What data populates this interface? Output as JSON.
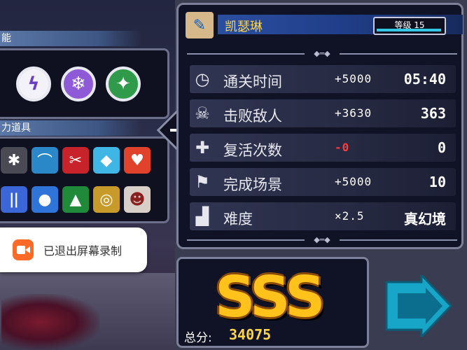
{
  "left_panel": {
    "skills_header": "能",
    "items_header": "力道具",
    "skills": [
      {
        "icon": "lightning-skill-icon",
        "glyph": "ϟ",
        "color": "#6a3fc4"
      },
      {
        "icon": "snowflake-skill-icon",
        "glyph": "❄",
        "color": "#8e5ad8"
      },
      {
        "icon": "leaf-skill-icon",
        "glyph": "✦",
        "color": "#2f9b4a"
      }
    ],
    "items": [
      {
        "icon": "spider-item-icon",
        "glyph": "✱",
        "color": "#4a4a55"
      },
      {
        "icon": "genie-lamp-item-icon",
        "glyph": "⌒",
        "color": "#2b88c8"
      },
      {
        "icon": "cannon-item-icon",
        "glyph": "✂",
        "color": "#c8222b"
      },
      {
        "icon": "crystal-item-icon",
        "glyph": "◆",
        "color": "#3fb6e6"
      },
      {
        "icon": "fire-heart-item-icon",
        "glyph": "♥",
        "color": "#e0422b"
      },
      {
        "icon": "candles-item-icon",
        "glyph": "ǀǀ",
        "color": "#3a66d8"
      },
      {
        "icon": "blue-potion-item-icon",
        "glyph": "●",
        "color": "#2f74d8"
      },
      {
        "icon": "green-hat-item-icon",
        "glyph": "▲",
        "color": "#1e8a3a"
      },
      {
        "icon": "golden-pot-item-icon",
        "glyph": "◎",
        "color": "#c89a2a"
      },
      {
        "icon": "horned-mask-item-icon",
        "glyph": "☻",
        "color": "#d8d0c8"
      }
    ]
  },
  "toast": {
    "text": "已退出屏幕录制"
  },
  "character": {
    "name": "凯瑟琳",
    "level": "等级 15"
  },
  "stats": [
    {
      "icon": "clock-icon",
      "glyph": "◷",
      "label": "通关时间",
      "bonus": "+5000",
      "value": "05:40"
    },
    {
      "icon": "skull-icon",
      "glyph": "☠",
      "label": "击败敌人",
      "bonus": "+3630",
      "value": "363"
    },
    {
      "icon": "tombstone-cross-icon",
      "glyph": "✚",
      "label": "复活次数",
      "bonus": "-0",
      "value": "0"
    },
    {
      "icon": "flag-icon",
      "glyph": "⚑",
      "label": "完成场景",
      "bonus": "+5000",
      "value": "10"
    },
    {
      "icon": "bar-chart-icon",
      "glyph": "▟",
      "label": "难度",
      "bonus": "×2.5",
      "value": "真幻境"
    }
  ],
  "score": {
    "grade": "SSS",
    "total_label": "总分:",
    "total_value": "34075"
  },
  "colors": {
    "gold": "#ffc21a",
    "accent_blue": "#2b4fa0",
    "penalty_red": "#ff3b3b",
    "next_cyan": "#18a6c8"
  }
}
